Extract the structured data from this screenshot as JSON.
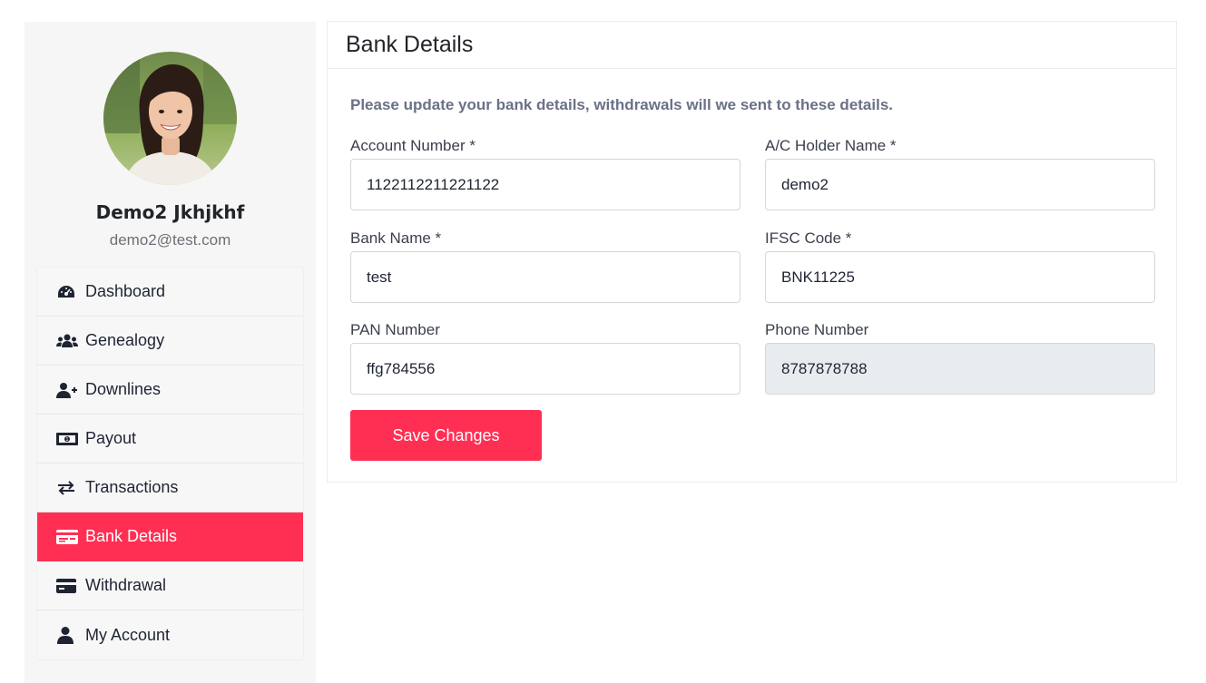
{
  "profile": {
    "name": "Demo2 Jkhjkhf",
    "email": "demo2@test.com"
  },
  "menu": [
    {
      "label": "Dashboard",
      "icon": "dashboard-icon",
      "active": false
    },
    {
      "label": "Genealogy",
      "icon": "users-icon",
      "active": false
    },
    {
      "label": "Downlines",
      "icon": "user-plus-icon",
      "active": false
    },
    {
      "label": "Payout",
      "icon": "money-bill-icon",
      "active": false
    },
    {
      "label": "Transactions",
      "icon": "exchange-icon",
      "active": false
    },
    {
      "label": "Bank Details",
      "icon": "bank-card-icon",
      "active": true
    },
    {
      "label": "Withdrawal",
      "icon": "credit-card-icon",
      "active": false
    },
    {
      "label": "My Account",
      "icon": "user-icon",
      "active": false
    }
  ],
  "card": {
    "title": "Bank Details",
    "intro": "Please update your bank details, withdrawals will we sent to these details."
  },
  "form": {
    "account_number": {
      "label": "Account Number *",
      "value": "1122112211221122"
    },
    "holder_name": {
      "label": "A/C Holder Name *",
      "value": "demo2"
    },
    "bank_name": {
      "label": "Bank Name *",
      "value": "test"
    },
    "ifsc_code": {
      "label": "IFSC Code *",
      "value": "BNK11225"
    },
    "pan_number": {
      "label": "PAN Number",
      "value": "ffg784556"
    },
    "phone_number": {
      "label": "Phone Number",
      "value": "8787878788"
    }
  },
  "actions": {
    "save_label": "Save Changes"
  },
  "colors": {
    "accent": "#ff2f53",
    "sidebar_bg": "#f6f6f6",
    "readonly_bg": "#e9ecef"
  }
}
